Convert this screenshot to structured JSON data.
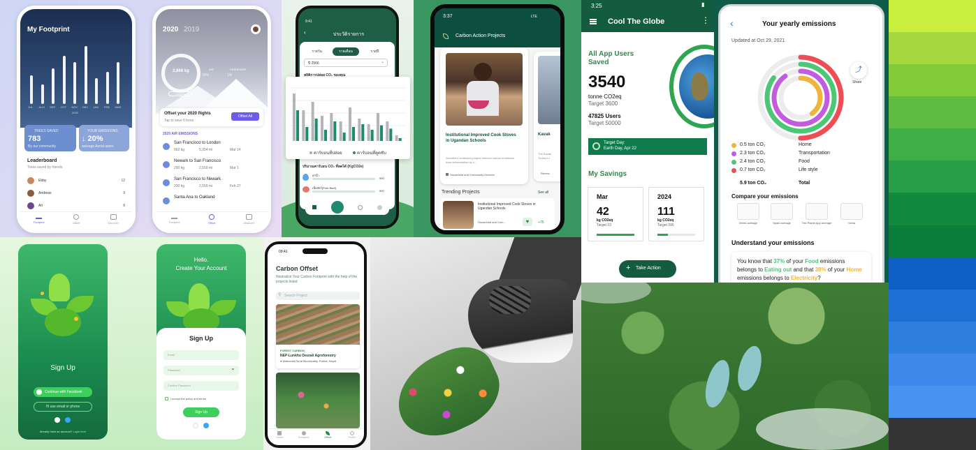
{
  "colors": {
    "brand_green": "#0f6b4d",
    "accent_purple": "#6c5ce7",
    "dark_green": "#1f5e46"
  },
  "fp1": {
    "title": "My Footprint",
    "months": [
      "JUL",
      "AUG",
      "SEP",
      "OCT",
      "NOV",
      "DEC",
      "JAN",
      "FEB",
      "MAR"
    ],
    "year": "2020",
    "bar_levels": [
      0.45,
      0.3,
      0.55,
      0.75,
      0.65,
      0.9,
      0.4,
      0.5,
      0.65
    ],
    "trees_label": "TREES SAVED",
    "trees_value": "783",
    "trees_sub": "By our community",
    "emis_label": "YOUR EMISSIONS",
    "emis_value": "↓ 20%",
    "emis_sub": "average Aerial users",
    "leaderboard_title": "Leaderboard",
    "leaderboard_sub": "Trees saved by friends",
    "leaders": [
      {
        "name": "Ebby",
        "score": "12"
      },
      {
        "name": "Andreas",
        "score": "9"
      },
      {
        "name": "Ari",
        "score": "8"
      }
    ],
    "tabs": [
      "Footprint",
      "Offset",
      "Discover"
    ]
  },
  "fp2": {
    "year_a": "2020",
    "year_b": "2019",
    "ring_value": "2,866 kg",
    "air_label": "AIR",
    "air_pct": "99%",
    "other_label": "RIDESHARE",
    "other_pct": "1%",
    "compare": "Compare",
    "offset_title": "Offset your 2020 flights",
    "offset_sub": "Tap to save 6 trees",
    "offset_btn": "Offset All",
    "section": "2020 AIR EMISSIONS",
    "flights": [
      {
        "route": "San Francisco to London",
        "kg": "662 kg",
        "mi": "5,354 mi",
        "date": "Mar 14"
      },
      {
        "route": "Newark to San Francisco",
        "kg": "290 kg",
        "mi": "2,559 mi",
        "date": "Mar 1"
      },
      {
        "route": "San Francisco to Newark",
        "kg": "290 kg",
        "mi": "2,559 mi",
        "date": "Feb 27"
      },
      {
        "route": "Santa Ana to Oakland",
        "kg": "",
        "mi": "",
        "date": ""
      }
    ],
    "tabs": [
      "Footprint",
      "Offset",
      "Discover"
    ]
  },
  "thai": {
    "time": "9:41",
    "title": "ประวัติรายการ",
    "seg": [
      "รายวัน",
      "รายเดือน",
      "รายปี"
    ],
    "select": "ปี 2566",
    "chart_title": "สถิติการปล่อย CO₂ ของคุณ",
    "legend_a": "คาร์บอนที่ปล่อย",
    "legend_b": "คาร์บอนที่ดูดซับ",
    "footer": "ปริมาณคาร์บอน CO₂ ที่ลดได้ (KgCO2e)",
    "rows": [
      {
        "label": "ค่าน้ำ",
        "value": "900"
      },
      {
        "label": "เนื้อสัตว์(Pork Beef)",
        "value": "900"
      }
    ],
    "bars_a": [
      0.85,
      0.55,
      0.7,
      0.45,
      0.5,
      0.35,
      0.6,
      0.4,
      0.3,
      0.5,
      0.35,
      0.1
    ],
    "bars_b": [
      0.55,
      0.25,
      0.4,
      0.2,
      0.35,
      0.15,
      0.25,
      0.3,
      0.2,
      0.28,
      0.22,
      0.05
    ]
  },
  "cap": {
    "time": "3:37",
    "status": "LTE",
    "title": "Carbon Action Projects",
    "card_title": "Institutional Improved Cook Stoves in Ugandan Schools",
    "card_desc": "Sensible's cookstove project reduces carbon emissions from deforestation by u...",
    "card_tag": "Household and Community Devices",
    "card2_title": "Kavak",
    "card2_desc": "The Kavak Turkey's I",
    "card2_tag": "Renew",
    "trending": "Trending Projects",
    "see_all": "See all",
    "trend_title": "Institutional Improved Cook Stoves in Ugandan Schools",
    "trend_tag": "Household and Com...",
    "trend_count": "+75"
  },
  "ctg": {
    "time": "3:25",
    "title": "Cool The Globe",
    "all_users": "All App Users Saved",
    "big": "3540",
    "unit": "tonne CO2eq",
    "target": "Target 3600",
    "users": "47825 Users",
    "users_target": "Target 50000",
    "target_day_label": "Target Day:",
    "target_day": "Earth Day, Apr 22",
    "savings": "My Savings",
    "card1": {
      "title": "Mar",
      "value": "42",
      "unit": "kg CO2eq",
      "target": "Target 33",
      "fill": 1.0
    },
    "card2": {
      "title": "2024",
      "value": "111",
      "unit": "kg CO2eq",
      "target": "Target 396",
      "fill": 0.28
    },
    "action": "Take Action"
  },
  "ye": {
    "title": "Your yearly emissions",
    "updated": "Updated at Oct 29, 2021",
    "share": "Share",
    "legend": [
      {
        "value": "0.5 ton CO₂",
        "label": "Home",
        "color": "#f0b43a"
      },
      {
        "value": "2.3 ton CO₂",
        "label": "Transportation",
        "color": "#c25be0"
      },
      {
        "value": "2.4 ton CO₂",
        "label": "Food",
        "color": "#4cc777"
      },
      {
        "value": "0.7 ton CO₂",
        "label": "Life style",
        "color": "#ef4d55"
      }
    ],
    "total_value": "5.9 ton CO₂",
    "total_label": "Total",
    "compare_title": "Compare your emissions",
    "compare": [
      "World average",
      "Spain average",
      "The Planet App average",
      "Greta"
    ],
    "understand": "Understand your emissions",
    "p1": "You know that ",
    "pct1": "37%",
    "p2": " of your ",
    "food": "Food",
    "p3": " emissions belongs to ",
    "eat": "Eating out",
    "p4": " and that ",
    "pct2": "38%",
    "p5": " of your ",
    "home": "Home",
    "p6": " emissions belongs to ",
    "elec": "Electricity",
    "p7": "?"
  },
  "signup": {
    "left_title": "Sign Up",
    "fb": "Continue with Facebook",
    "email": "I'll use email or phone",
    "hello": "Hello.",
    "create": "Create Your Account",
    "form_title": "Sign Up",
    "email_ph": "Email",
    "password_ph": "Password",
    "confirm_ph": "Confirm Password",
    "agree": "I accept the policy and terms",
    "btn": "Sign Up",
    "left_footer": "Already have an account?",
    "login": "Login here"
  },
  "co": {
    "time": "09:41",
    "title": "Carbon Offset",
    "desc": "Neutralize Your Carbon Footprint with the help of the projects listed",
    "search": "Search Project",
    "tag": "FOREST CARBON",
    "proj": "NEP-Lunkhu Deurali Agroforestry",
    "loc": "Walkanda Rural Municipality, Parbat, Nepal",
    "tabs": [
      "Home",
      "Footprint",
      "Offset",
      "Profile"
    ]
  },
  "swatches": [
    "#c8f03c",
    "#a5d83c",
    "#82cc3a",
    "#5fbc41",
    "#3fae45",
    "#289e48",
    "#128a3e",
    "#0b7d3a",
    "#0e5fc4",
    "#1e6fd4",
    "#2f7fdf",
    "#3d88ea",
    "#4892f0",
    "#333333"
  ]
}
